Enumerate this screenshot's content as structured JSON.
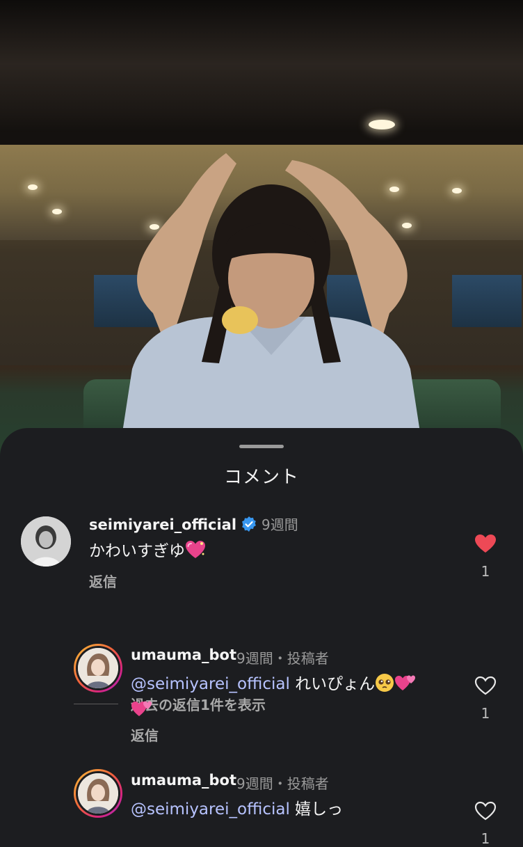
{
  "sheet": {
    "title": "コメント"
  },
  "comments": [
    {
      "username": "seimiyarei_official",
      "verified": true,
      "time": "9週間",
      "text": "かわいすぎゆ",
      "text_emoji": "sparkling-heart",
      "reply_label": "返信",
      "liked": true,
      "like_count": "1",
      "view_replies_label": "過去の返信1件を表示"
    }
  ],
  "replies": [
    {
      "username": "umauma_bot",
      "time": "9週間・投稿者",
      "mention": "@seimiyarei_official",
      "text": " れいぴょん",
      "emojis": [
        "pleading-face",
        "two-hearts",
        "two-hearts"
      ],
      "reply_label": "返信",
      "liked": false,
      "like_count": "1"
    },
    {
      "username": "umauma_bot",
      "time": "9週間・投稿者",
      "mention": "@seimiyarei_official",
      "text": " 嬉しっ",
      "liked": false,
      "like_count": "1"
    }
  ],
  "colors": {
    "accent_like": "#ed4956",
    "mention": "#b7c3ff",
    "verified": "#3897f0",
    "background": "#1c1d20"
  }
}
